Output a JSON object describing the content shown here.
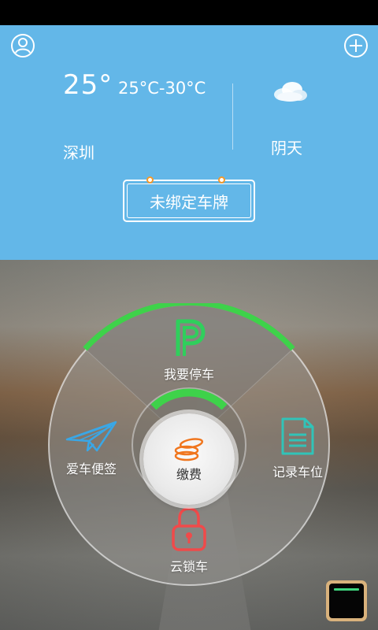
{
  "weather": {
    "temperature": "25°",
    "range": "25°C-30°C",
    "city": "深圳",
    "condition": "阴天",
    "condition_icon": "cloud-icon"
  },
  "header": {
    "avatar_icon": "user-icon",
    "add_icon": "plus-icon"
  },
  "plate": {
    "label": "未绑定车牌"
  },
  "menu": {
    "park": {
      "label": "我要停车",
      "icon": "parking-icon"
    },
    "notes": {
      "label": "爱车便签",
      "icon": "paper-plane-icon"
    },
    "record": {
      "label": "记录车位",
      "icon": "document-icon"
    },
    "lock": {
      "label": "云锁车",
      "icon": "lock-icon"
    },
    "pay": {
      "label": "缴费",
      "icon": "coins-icon"
    }
  },
  "colors": {
    "sky": "#63b7e8",
    "accent_green": "#3ed24a",
    "park_green": "#2fcf5c",
    "plane_blue": "#3aa7e6",
    "record_teal": "#31c3b8",
    "lock_red": "#f04a4a",
    "pay_orange": "#f0761e"
  }
}
